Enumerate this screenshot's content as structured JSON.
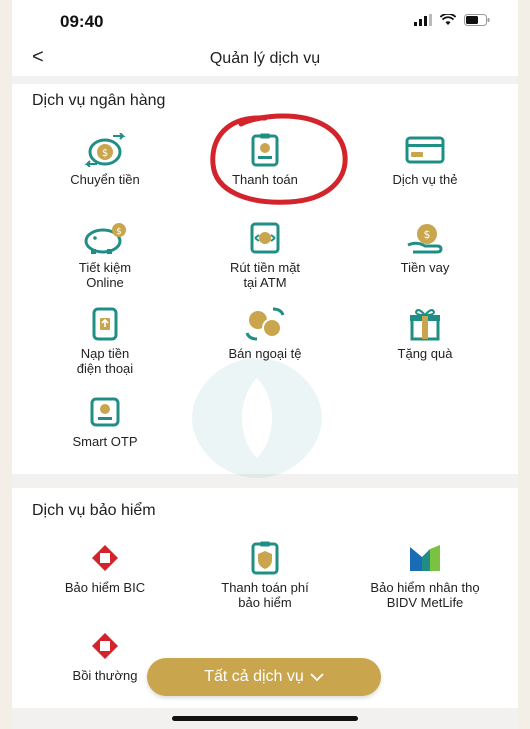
{
  "status": {
    "time": "09:40"
  },
  "header": {
    "back": "<",
    "title": "Quản lý dịch vụ"
  },
  "banking": {
    "title": "Dịch vụ ngân hàng",
    "items": [
      {
        "label1": "Chuyển tiền",
        "label2": "",
        "icon": "transfer-icon"
      },
      {
        "label1": "Thanh toán",
        "label2": "",
        "icon": "payment-icon"
      },
      {
        "label1": "Dịch vụ thẻ",
        "label2": "",
        "icon": "card-icon"
      },
      {
        "label1": "Tiết kiệm",
        "label2": "Online",
        "icon": "piggy-bank-icon"
      },
      {
        "label1": "Rút tiền mặt",
        "label2": "tại ATM",
        "icon": "atm-icon"
      },
      {
        "label1": "Tiền vay",
        "label2": "",
        "icon": "loan-icon"
      },
      {
        "label1": "Nạp tiền",
        "label2": "điện thoại",
        "icon": "phone-topup-icon"
      },
      {
        "label1": "Bán ngoại tệ",
        "label2": "",
        "icon": "currency-exchange-icon"
      },
      {
        "label1": "Tặng quà",
        "label2": "",
        "icon": "gift-icon"
      },
      {
        "label1": "Smart OTP",
        "label2": "",
        "icon": "otp-icon"
      }
    ]
  },
  "insurance": {
    "title": "Dịch vụ bảo hiểm",
    "items": [
      {
        "label1": "Bảo hiểm BIC",
        "label2": "",
        "icon": "bic-logo-icon"
      },
      {
        "label1": "Thanh toán phí",
        "label2": "bảo hiểm",
        "icon": "insurance-payment-icon"
      },
      {
        "label1": "Bảo hiểm nhân thọ",
        "label2": "BIDV MetLife",
        "icon": "metlife-logo-icon"
      },
      {
        "label1": "Bồi thường",
        "label2": "",
        "icon": "claim-logo-icon"
      }
    ]
  },
  "fab": {
    "label": "Tất cả dịch vụ",
    "icon": "chevron-down-icon"
  },
  "colors": {
    "teal": "#1f8f86",
    "gold": "#c9a54e",
    "red": "#d3242c"
  }
}
